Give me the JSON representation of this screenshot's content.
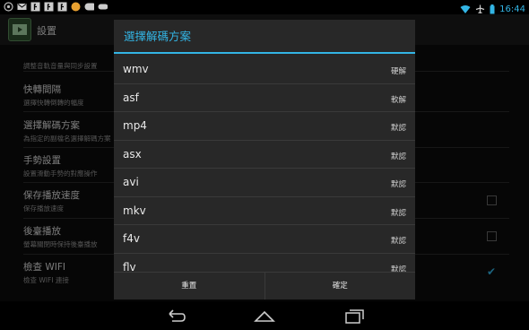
{
  "status_bar": {
    "time": "16:44",
    "left_icons": [
      "app-notification-icon",
      "mail-icon",
      "f-icon",
      "f-icon",
      "f-icon",
      "orange-badge-icon",
      "chat-icon",
      "gamepad-icon"
    ],
    "right_icons": [
      "wifi-icon",
      "airplane-icon",
      "battery-icon"
    ]
  },
  "action_bar": {
    "title": "設置"
  },
  "settings": {
    "items": [
      {
        "title": "",
        "subtitle": "調整音軌音量與同步設置"
      },
      {
        "title": "快轉間隔",
        "subtitle": "選擇快轉倒轉的幅度"
      },
      {
        "title": "選擇解碼方案",
        "subtitle": "為指定的副檔名選擇解碼方案"
      },
      {
        "title": "手勢設置",
        "subtitle": "設置滑動手勢的對應操作"
      },
      {
        "title": "保存播放速度",
        "subtitle": "保存播放速度",
        "checked": false
      },
      {
        "title": "後臺播放",
        "subtitle": "螢幕關閉時保持後臺播放",
        "checked": false
      },
      {
        "title": "檢查 WIFI",
        "subtitle": "檢查 WIFI 連接",
        "checked": true
      }
    ]
  },
  "dialog": {
    "title": "選擇解碼方案",
    "rows": [
      {
        "format": "wmv",
        "decoder": "硬解"
      },
      {
        "format": "asf",
        "decoder": "軟解"
      },
      {
        "format": "mp4",
        "decoder": "默認"
      },
      {
        "format": "asx",
        "decoder": "默認"
      },
      {
        "format": "avi",
        "decoder": "默認"
      },
      {
        "format": "mkv",
        "decoder": "默認"
      },
      {
        "format": "f4v",
        "decoder": "默認"
      },
      {
        "format": "flv",
        "decoder": "默認"
      }
    ],
    "buttons": {
      "reset": "重置",
      "confirm": "確定"
    }
  },
  "colors": {
    "accent": "#33b5e5",
    "dialog_bg": "#282828"
  }
}
